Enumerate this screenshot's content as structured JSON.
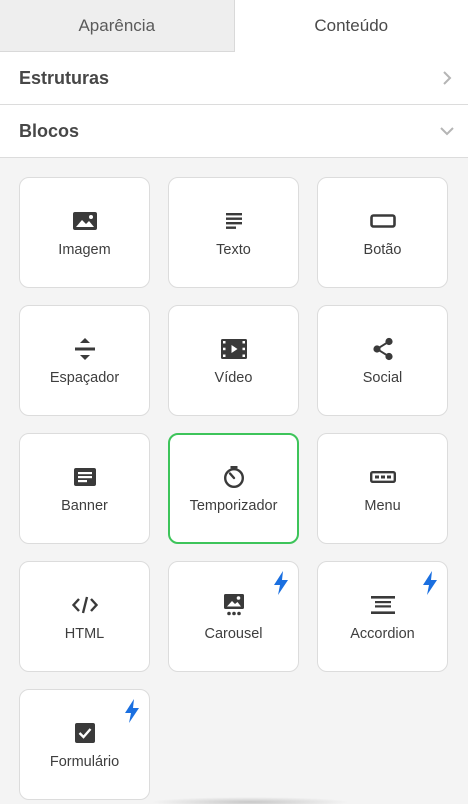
{
  "tabs": [
    {
      "label": "Aparência",
      "active": false
    },
    {
      "label": "Conteúdo",
      "active": true
    }
  ],
  "sections": {
    "estruturas": {
      "label": "Estruturas",
      "icon": "chevron-right-icon"
    },
    "blocos": {
      "label": "Blocos",
      "icon": "chevron-down-icon"
    }
  },
  "blocks": [
    {
      "label": "Imagem",
      "icon": "image-icon"
    },
    {
      "label": "Texto",
      "icon": "text-lines-icon"
    },
    {
      "label": "Botão",
      "icon": "button-icon"
    },
    {
      "label": "Espaçador",
      "icon": "spacer-icon"
    },
    {
      "label": "Vídeo",
      "icon": "video-icon"
    },
    {
      "label": "Social",
      "icon": "share-icon"
    },
    {
      "label": "Banner",
      "icon": "banner-icon"
    },
    {
      "label": "Temporizador",
      "icon": "timer-icon",
      "selected": true
    },
    {
      "label": "Menu",
      "icon": "menu-icon"
    },
    {
      "label": "HTML",
      "icon": "code-icon"
    },
    {
      "label": "Carousel",
      "icon": "carousel-icon",
      "badge": "bolt-icon"
    },
    {
      "label": "Accordion",
      "icon": "accordion-icon",
      "badge": "bolt-icon"
    },
    {
      "label": "Formulário",
      "icon": "checkbox-icon",
      "badge": "bolt-icon"
    }
  ],
  "colors": {
    "selected_border": "#3dc45a",
    "bolt": "#1a6fe0",
    "icon": "#3a3a3a"
  }
}
